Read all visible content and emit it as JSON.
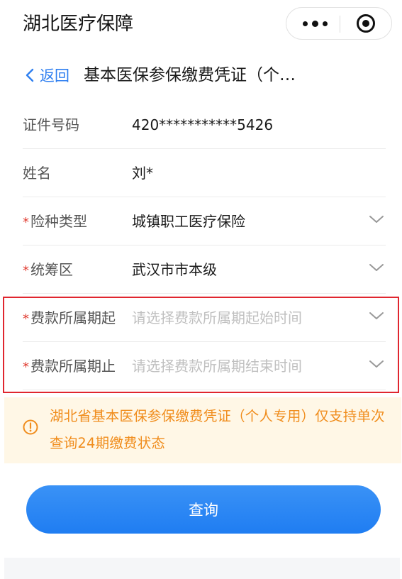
{
  "app": {
    "title": "湖北医疗保障"
  },
  "nav": {
    "back_label": "返回",
    "page_title": "基本医保参保缴费凭证（个…"
  },
  "form": {
    "fields": [
      {
        "label": "证件号码",
        "value": "420***********5426",
        "required": false,
        "placeholder": false,
        "dropdown": false
      },
      {
        "label": "姓名",
        "value": "刘*",
        "required": false,
        "placeholder": false,
        "dropdown": false
      },
      {
        "label": "险种类型",
        "value": "城镇职工医疗保险",
        "required": true,
        "placeholder": false,
        "dropdown": true
      },
      {
        "label": "统筹区",
        "value": "武汉市市本级",
        "required": true,
        "placeholder": false,
        "dropdown": true
      },
      {
        "label": "费款所属期起",
        "value": "请选择费款所属期起始时间",
        "required": true,
        "placeholder": true,
        "dropdown": true
      },
      {
        "label": "费款所属期止",
        "value": "请选择费款所属期结束时间",
        "required": true,
        "placeholder": true,
        "dropdown": true
      }
    ],
    "required_mark": "*"
  },
  "notice": {
    "icon": "info-circle-icon",
    "text": "湖北省基本医保参保缴费凭证（个人专用）仅支持单次查询24期缴费状态"
  },
  "actions": {
    "query_label": "查询"
  },
  "colors": {
    "accent": "#2f7ff0",
    "required": "#e03a2f",
    "notice_text": "#f08d1d",
    "notice_bg": "#fff7e6",
    "highlight": "#e0262f"
  }
}
